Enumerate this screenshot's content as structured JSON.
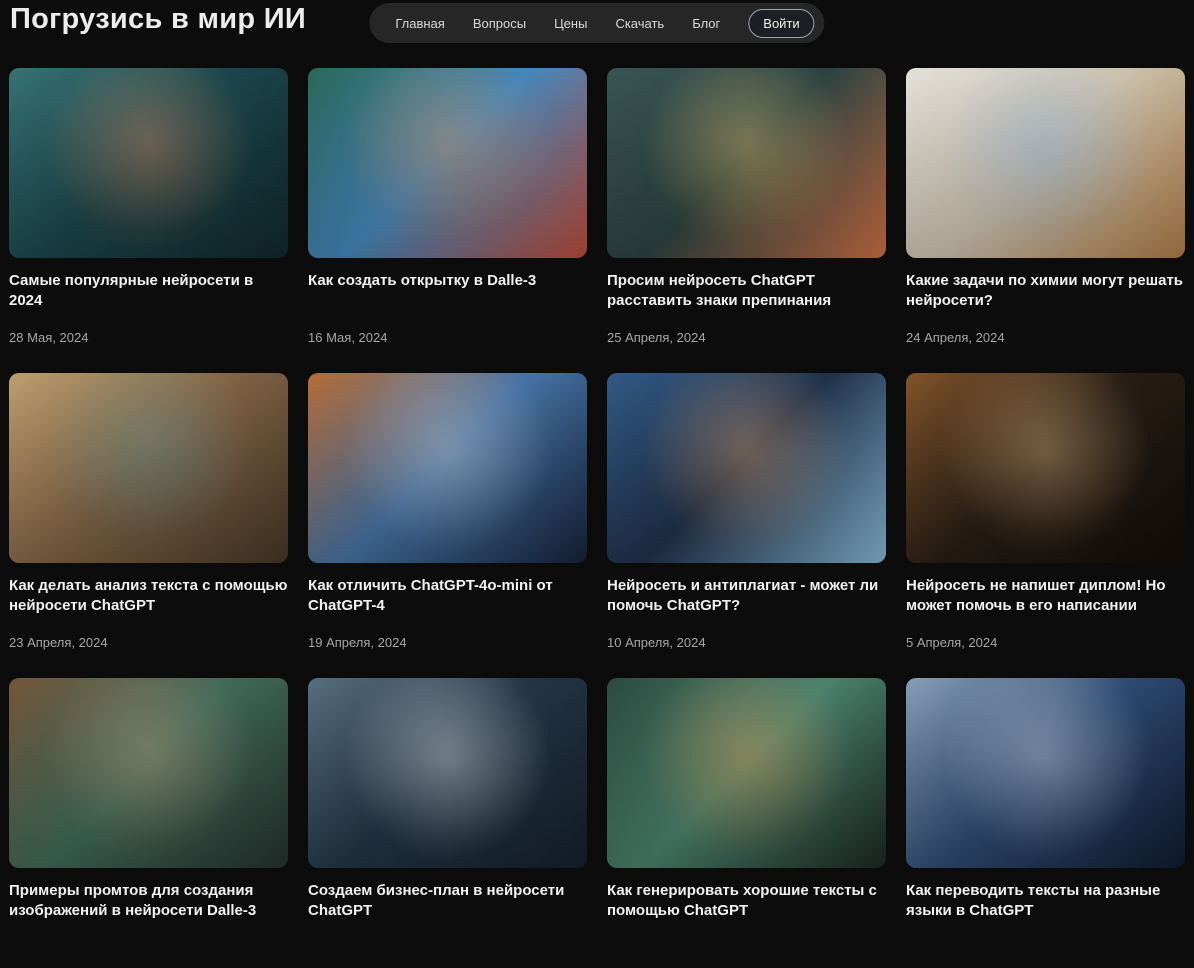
{
  "page": {
    "title": "Погрузись в мир ИИ",
    "background_color": "#0c0c0c",
    "nav_pill_color": "#272727",
    "title_color": "#ececec",
    "date_color": "#a6a6a6"
  },
  "nav": {
    "items": [
      "Главная",
      "Вопросы",
      "Цены",
      "Скачать",
      "Блог"
    ],
    "login_label": "Войти"
  },
  "articles": [
    {
      "title": "Самые популярные нейросети в 2024",
      "date": "28 Мая, 2024",
      "image": "cyberpunk-woman-with-smartphone-in-teal-city",
      "palette": [
        "#3a7a7d",
        "#1d4a50",
        "#d4703a",
        "#122b30"
      ]
    },
    {
      "title": "Как создать открытку в Dalle-3",
      "date": "16 Мая, 2024",
      "image": "colorful-travel-postcards-collage",
      "palette": [
        "#2e6e5e",
        "#4a8fc7",
        "#d9833b",
        "#c94f3d"
      ]
    },
    {
      "title": "Просим нейросеть ChatGPT расставить знаки препинания",
      "date": "25 Апреля, 2024",
      "image": "toy-alphabet-letters-and-animals-on-shelves",
      "palette": [
        "#3c5a58",
        "#2f4745",
        "#e5b84d",
        "#d9764a"
      ]
    },
    {
      "title": "Какие задачи по химии могут решать нейросети?",
      "date": "24 Апреля, 2024",
      "image": "watercolor-chemistry-flasks-on-wooden-table",
      "palette": [
        "#f2efe8",
        "#d8cdb8",
        "#7aa7d9",
        "#b8834a"
      ]
    },
    {
      "title": "Как делать анализ текста с помощью нейросети ChatGPT",
      "date": "23 Апреля, 2024",
      "image": "person-writing-notes-among-papers-and-books",
      "palette": [
        "#c9a876",
        "#8a6a4a",
        "#3f7a72",
        "#4a3a28"
      ]
    },
    {
      "title": "Как отличить ChatGPT-4o-mini от ChatGPT-4",
      "date": "19 Апреля, 2024",
      "image": "amber-and-silver-cyborg-faces-facing-each-other",
      "palette": [
        "#c2733a",
        "#4a7ab0",
        "#b8bfc9",
        "#17253d"
      ]
    },
    {
      "title": "Нейросеть и антиплагиат - может ли помочь ChatGPT?",
      "date": "10 Апреля, 2024",
      "image": "cartoon-man-examining-map-on-computer-screen",
      "palette": [
        "#35608f",
        "#22344f",
        "#d98f4f",
        "#8fc3e0"
      ]
    },
    {
      "title": "Нейросеть не напишет диплом! Но может помочь в его написании",
      "date": "5 Апреля, 2024",
      "image": "man-typing-on-laptop-in-dark-lamp-lit-room",
      "palette": [
        "#8a5a2e",
        "#2a1f16",
        "#d9a05a",
        "#120d08"
      ]
    },
    {
      "title": "Примеры промтов для создания изображений в нейросети Dalle-3",
      "image": "intricate-fantasy-wooden-village",
      "palette": [
        "#7a5c3d",
        "#44705f",
        "#b08a58",
        "#273530"
      ]
    },
    {
      "title": "Создаем бизнес-план в нейросети ChatGPT",
      "image": "robot-writing-business-plan-on-monitor",
      "palette": [
        "#5d7687",
        "#24384a",
        "#dfe7ec",
        "#16222e"
      ]
    },
    {
      "title": "Как генерировать хорошие тексты с помощью ChatGPT",
      "image": "laptop-with-code-and-orange-drink-on-desk",
      "palette": [
        "#2f4f44",
        "#4f8a74",
        "#d98a2e",
        "#1d2a24"
      ]
    },
    {
      "title": "Как переводить тексты на разные языки в ChatGPT",
      "image": "robot-girl-at-blue-translation-screen",
      "palette": [
        "#8fa8c2",
        "#31507a",
        "#c2cfdd",
        "#101d33"
      ]
    }
  ]
}
